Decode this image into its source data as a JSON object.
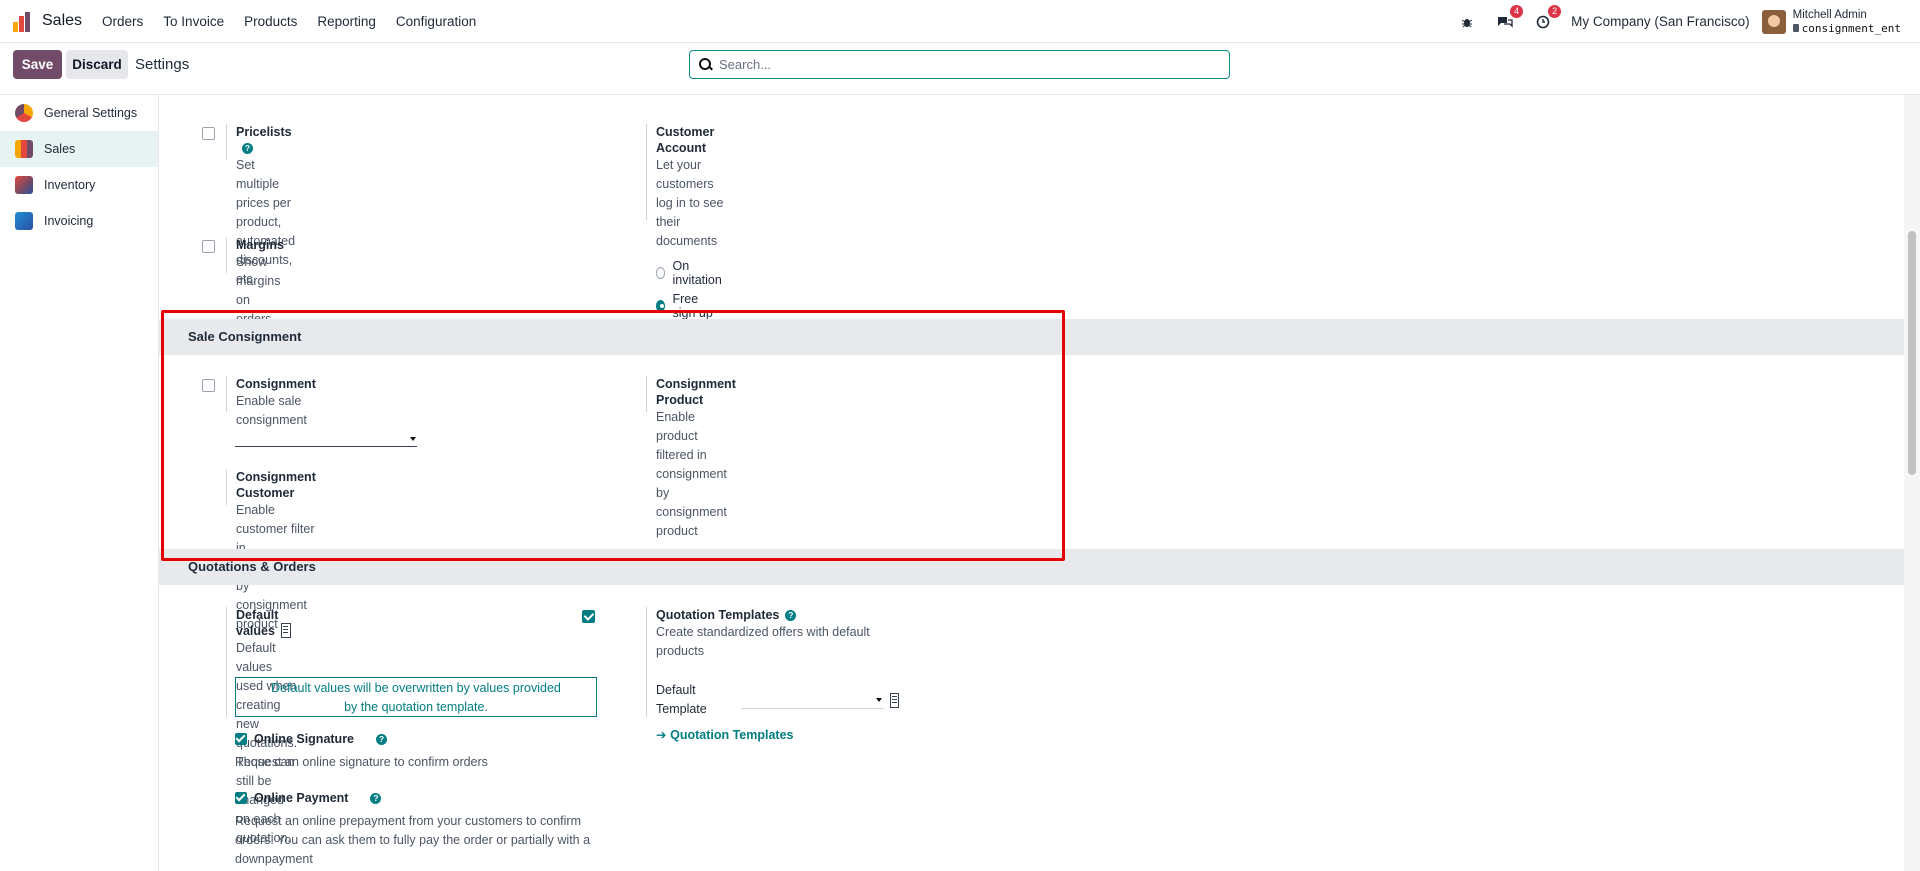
{
  "navbar": {
    "app_name": "Sales",
    "menu": [
      "Orders",
      "To Invoice",
      "Products",
      "Reporting",
      "Configuration"
    ],
    "messages_badge": "4",
    "activity_badge": "2",
    "company": "My Company (San Francisco)",
    "user_name": "Mitchell Admin",
    "database": "consignment_ent"
  },
  "controls": {
    "save_label": "Save",
    "discard_label": "Discard",
    "title": "Settings",
    "search_placeholder": "Search..."
  },
  "sidebar": {
    "items": [
      {
        "label": "General Settings",
        "icon": "general-settings-icon"
      },
      {
        "label": "Sales",
        "icon": "sales-icon",
        "active": true
      },
      {
        "label": "Inventory",
        "icon": "inventory-icon"
      },
      {
        "label": "Invoicing",
        "icon": "invoicing-icon"
      }
    ]
  },
  "pricing": {
    "pricelists_label": "Pricelists",
    "pricelists_desc": "Set multiple prices per product, automated discounts, etc.",
    "customer_account_label": "Customer Account",
    "customer_account_desc": "Let your customers log in to see their documents",
    "radio_invitation": "On invitation",
    "radio_signup": "Free sign up",
    "margins_label": "Margins",
    "margins_desc": "Show margins on orders"
  },
  "consignment": {
    "section_title": "Sale Consignment",
    "consignment_label": "Consignment",
    "consignment_desc": "Enable sale consignment",
    "product_label": "Consignment Product",
    "product_desc": "Enable product filtered in consignment by consignment product",
    "customer_label": "Consignment Customer",
    "customer_desc": "Enable customer filter in consignment by consignment product"
  },
  "quotations": {
    "section_title": "Quotations & Orders",
    "default_values_label": "Default values",
    "default_values_desc_1": "Default values used when creating new quotations. Those can",
    "default_values_desc_2": "still be changed on each quotation.",
    "alert_line_1": "Default values will be overwritten by values provided",
    "alert_line_2": "by the quotation template.",
    "online_signature_label": "Online Signature",
    "online_signature_desc": "Request an online signature to confirm orders",
    "online_payment_label": "Online Payment",
    "online_payment_desc_1": "Request an online prepayment from your customers to confirm",
    "online_payment_desc_2": "orders. You can ask them to fully pay the order or partially with a",
    "online_payment_desc_3": "downpayment",
    "templates_label": "Quotation Templates",
    "templates_desc": "Create standardized offers with default products",
    "default_template_label": "Default Template",
    "templates_link": "Quotation Templates"
  }
}
